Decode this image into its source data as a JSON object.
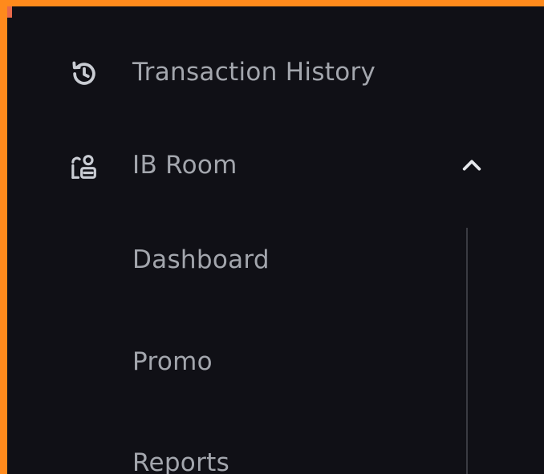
{
  "menu": {
    "items": [
      {
        "label": "Transaction History",
        "icon": "history-icon"
      },
      {
        "label": "IB Room",
        "icon": "ib-room-icon",
        "expanded": true,
        "chevron": "chevron-up-icon"
      }
    ],
    "ib_room_submenu": [
      {
        "label": "Dashboard"
      },
      {
        "label": "Promo"
      },
      {
        "label": "Reports"
      }
    ]
  },
  "colors": {
    "frame_border": "#ff8a1c",
    "background": "#101016",
    "text": "#a3a6ad",
    "icon": "#c9ccd3",
    "divider": "#3a3b42"
  }
}
